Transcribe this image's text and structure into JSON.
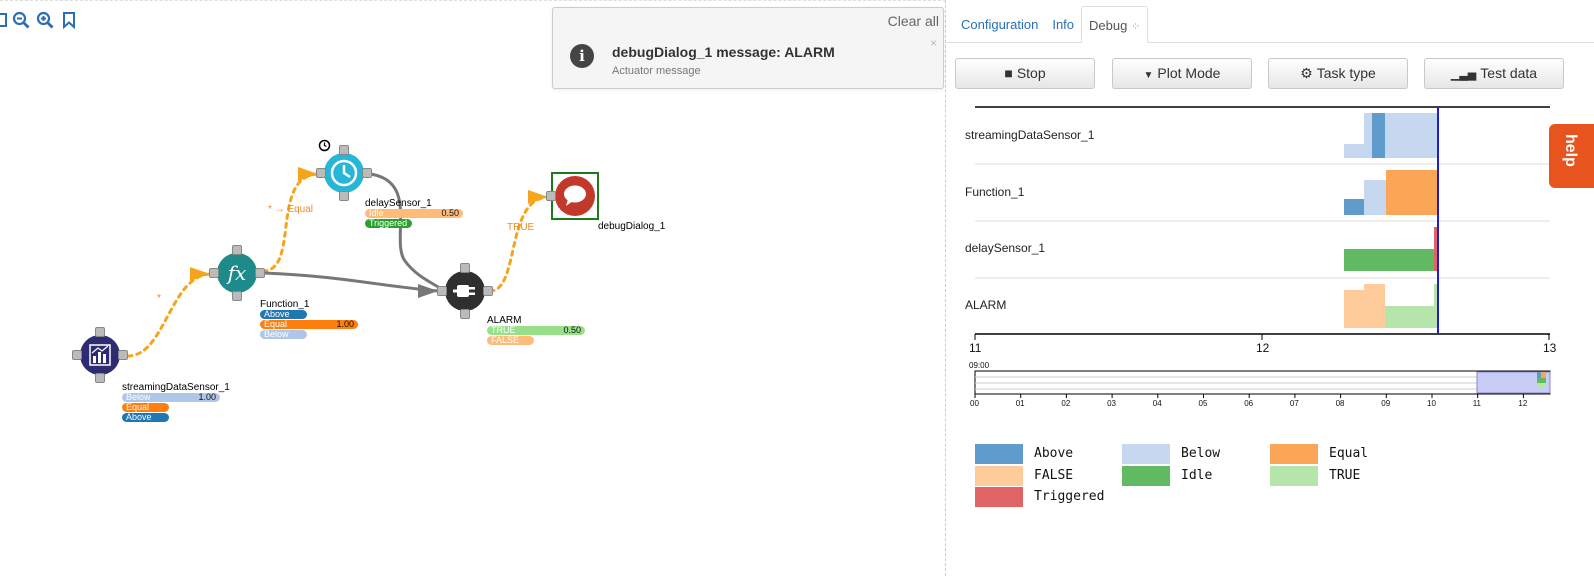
{
  "toolbar": {
    "icons": [
      "fit-icon",
      "zoom-out-icon",
      "zoom-in-icon",
      "bookmark-icon"
    ]
  },
  "nodes": {
    "streaming": {
      "name": "streamingDataSensor_1",
      "pills": [
        {
          "label": "Below",
          "value": "1.00",
          "color": "#aec7e8"
        },
        {
          "label": "Equal",
          "value": "",
          "color": "#ff7f0e"
        },
        {
          "label": "Above",
          "value": "",
          "color": "#1f77b4"
        }
      ]
    },
    "function": {
      "name": "Function_1",
      "pills": [
        {
          "label": "Above",
          "value": "",
          "color": "#1f77b4"
        },
        {
          "label": "Equal",
          "value": "1.00",
          "color": "#ff7f0e"
        },
        {
          "label": "Below",
          "value": "",
          "color": "#aec7e8"
        }
      ]
    },
    "delay": {
      "name": "delaySensor_1",
      "pills": [
        {
          "label": "Idle",
          "value": "0.50",
          "color": "#ffbb78"
        },
        {
          "label": "Triggered",
          "value": "",
          "color": "#2ca02c"
        }
      ]
    },
    "alarm": {
      "name": "ALARM",
      "pills": [
        {
          "label": "TRUE",
          "value": "0.50",
          "color": "#98df8a"
        },
        {
          "label": "FALSE",
          "value": "",
          "color": "#ffbb78"
        }
      ]
    },
    "debug": {
      "name": "debugDialog_1"
    }
  },
  "wire_labels": {
    "equal": "* → Equal",
    "true": "TRUE",
    "star": "*"
  },
  "notification": {
    "clear": "Clear all",
    "close": "×",
    "title": "debugDialog_1 message: ALARM",
    "subtitle": "Actuator message"
  },
  "tabs": [
    "Configuration",
    "Info",
    "Debug"
  ],
  "buttons": {
    "stop": "Stop",
    "plot": "Plot Mode",
    "task": "Task type",
    "test": "Test data"
  },
  "help": "help",
  "chart_data": {
    "type": "timeline",
    "rows": [
      "streamingDataSensor_1",
      "Function_1",
      "delaySensor_1",
      "ALARM"
    ],
    "x_ticks": [
      "11",
      "12",
      "13"
    ],
    "mini_ticks": [
      "00",
      "01",
      "02",
      "03",
      "04",
      "05",
      "06",
      "07",
      "08",
      "09",
      "10",
      "11",
      "12"
    ],
    "mini_label": "09:00",
    "legend": [
      {
        "name": "Above",
        "color": "#5f9ccb"
      },
      {
        "name": "Below",
        "color": "#c5d8ef"
      },
      {
        "name": "Equal",
        "color": "#fba656"
      },
      {
        "name": "FALSE",
        "color": "#fdcc9a"
      },
      {
        "name": "Idle",
        "color": "#61b961"
      },
      {
        "name": "TRUE",
        "color": "#b6e5ac"
      },
      {
        "name": "Triggered",
        "color": "#e06467"
      }
    ]
  }
}
